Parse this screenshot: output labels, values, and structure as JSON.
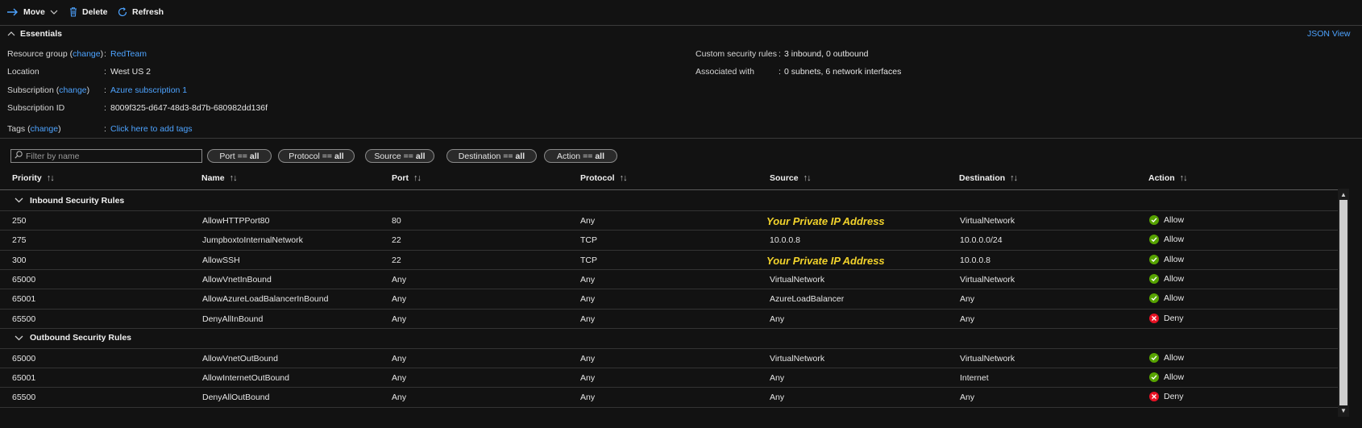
{
  "toolbar": {
    "move_label": "Move",
    "delete_label": "Delete",
    "refresh_label": "Refresh"
  },
  "essentials": {
    "title": "Essentials",
    "json_view": "JSON View",
    "resource_group": {
      "label": "Resource group",
      "change": "change",
      "value": "RedTeam"
    },
    "location": {
      "label": "Location",
      "value": "West US 2"
    },
    "subscription": {
      "label": "Subscription",
      "change": "change",
      "value": "Azure subscription 1"
    },
    "subscription_id": {
      "label": "Subscription ID",
      "value": "8009f325-d647-48d3-8d7b-680982dd136f"
    },
    "tags": {
      "label": "Tags",
      "change": "change",
      "value": "Click here to add tags"
    },
    "custom_rules": {
      "label": "Custom security rules",
      "value": "3 inbound, 0 outbound"
    },
    "associated": {
      "label": "Associated with",
      "value": "0 subnets, 6 network interfaces"
    }
  },
  "filters": {
    "search_placeholder": "Filter by name",
    "pills": [
      {
        "name": "Port ==",
        "value": "all"
      },
      {
        "name": "Protocol ==",
        "value": "all"
      },
      {
        "name": "Source ==",
        "value": "all"
      },
      {
        "name": "Destination ==",
        "value": "all"
      },
      {
        "name": "Action ==",
        "value": "all"
      }
    ]
  },
  "table": {
    "columns": [
      "Priority",
      "Name",
      "Port",
      "Protocol",
      "Source",
      "Destination",
      "Action"
    ],
    "groups": [
      {
        "title": "Inbound Security Rules",
        "rows": [
          {
            "priority": "250",
            "name": "AllowHTTPPort80",
            "port": "80",
            "protocol": "Any",
            "source": "Your Private IP Address",
            "destination": "VirtualNetwork",
            "action": "Allow",
            "highlight": true
          },
          {
            "priority": "275",
            "name": "JumpboxtoInternalNetwork",
            "port": "22",
            "protocol": "TCP",
            "source": "10.0.0.8",
            "destination": "10.0.0.0/24",
            "action": "Allow"
          },
          {
            "priority": "300",
            "name": "AllowSSH",
            "port": "22",
            "protocol": "TCP",
            "source": "Your Private IP Address",
            "destination": "10.0.0.8",
            "action": "Allow",
            "highlight": true
          },
          {
            "priority": "65000",
            "name": "AllowVnetInBound",
            "port": "Any",
            "protocol": "Any",
            "source": "VirtualNetwork",
            "destination": "VirtualNetwork",
            "action": "Allow"
          },
          {
            "priority": "65001",
            "name": "AllowAzureLoadBalancerInBound",
            "port": "Any",
            "protocol": "Any",
            "source": "AzureLoadBalancer",
            "destination": "Any",
            "action": "Allow"
          },
          {
            "priority": "65500",
            "name": "DenyAllInBound",
            "port": "Any",
            "protocol": "Any",
            "source": "Any",
            "destination": "Any",
            "action": "Deny"
          }
        ]
      },
      {
        "title": "Outbound Security Rules",
        "rows": [
          {
            "priority": "65000",
            "name": "AllowVnetOutBound",
            "port": "Any",
            "protocol": "Any",
            "source": "VirtualNetwork",
            "destination": "VirtualNetwork",
            "action": "Allow"
          },
          {
            "priority": "65001",
            "name": "AllowInternetOutBound",
            "port": "Any",
            "protocol": "Any",
            "source": "Any",
            "destination": "Internet",
            "action": "Allow"
          },
          {
            "priority": "65500",
            "name": "DenyAllOutBound",
            "port": "Any",
            "protocol": "Any",
            "source": "Any",
            "destination": "Any",
            "action": "Deny"
          }
        ]
      }
    ]
  },
  "colors": {
    "background": "#121212",
    "link": "#4da3ff",
    "allow": "#57a300",
    "deny": "#e81123",
    "highlight": "#f2d32b"
  },
  "icons": {
    "move": "arrow-right-icon",
    "delete": "trash-icon",
    "refresh": "refresh-icon",
    "allow": "check-circle-icon",
    "deny": "x-circle-icon"
  }
}
